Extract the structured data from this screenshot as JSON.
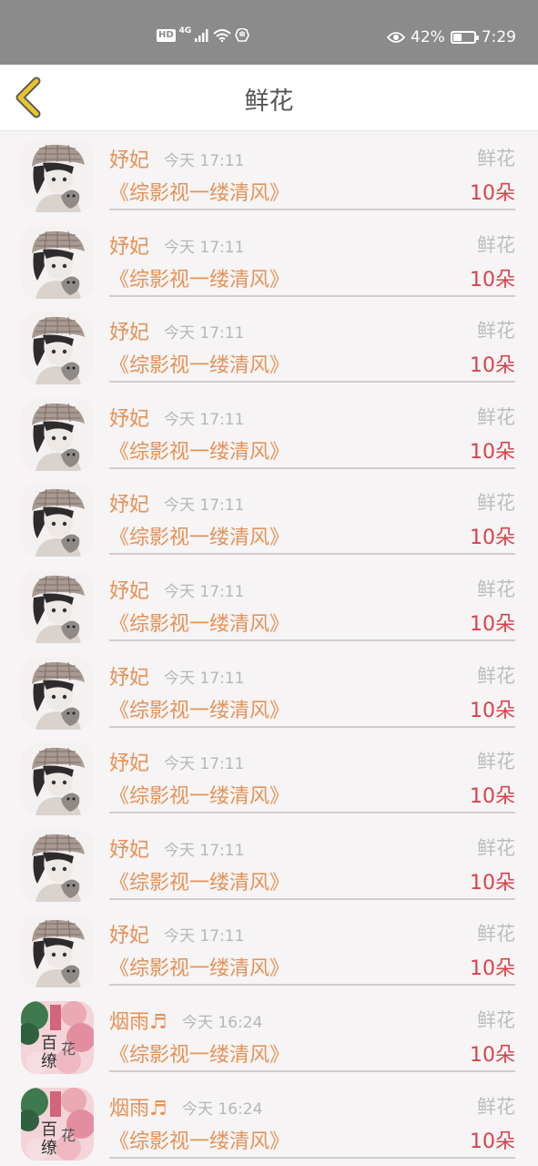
{
  "status_bar": {
    "hd": "HD",
    "network": "4G",
    "battery_percent": "42%",
    "battery_level": 0.42,
    "time": "7:29"
  },
  "nav": {
    "back_icon": "chevron-left-icon",
    "title": "鲜花",
    "accent_color": "#e8c42a"
  },
  "records": [
    {
      "user": "妤妃",
      "time": "今天 17:11",
      "gift": "鲜花",
      "book": "《综影视一缕清风》",
      "count": "10朵",
      "avatar": "cap-girl-avatar"
    },
    {
      "user": "妤妃",
      "time": "今天 17:11",
      "gift": "鲜花",
      "book": "《综影视一缕清风》",
      "count": "10朵",
      "avatar": "cap-girl-avatar"
    },
    {
      "user": "妤妃",
      "time": "今天 17:11",
      "gift": "鲜花",
      "book": "《综影视一缕清风》",
      "count": "10朵",
      "avatar": "cap-girl-avatar"
    },
    {
      "user": "妤妃",
      "time": "今天 17:11",
      "gift": "鲜花",
      "book": "《综影视一缕清风》",
      "count": "10朵",
      "avatar": "cap-girl-avatar"
    },
    {
      "user": "妤妃",
      "time": "今天 17:11",
      "gift": "鲜花",
      "book": "《综影视一缕清风》",
      "count": "10朵",
      "avatar": "cap-girl-avatar"
    },
    {
      "user": "妤妃",
      "time": "今天 17:11",
      "gift": "鲜花",
      "book": "《综影视一缕清风》",
      "count": "10朵",
      "avatar": "cap-girl-avatar"
    },
    {
      "user": "妤妃",
      "time": "今天 17:11",
      "gift": "鲜花",
      "book": "《综影视一缕清风》",
      "count": "10朵",
      "avatar": "cap-girl-avatar"
    },
    {
      "user": "妤妃",
      "time": "今天 17:11",
      "gift": "鲜花",
      "book": "《综影视一缕清风》",
      "count": "10朵",
      "avatar": "cap-girl-avatar"
    },
    {
      "user": "妤妃",
      "time": "今天 17:11",
      "gift": "鲜花",
      "book": "《综影视一缕清风》",
      "count": "10朵",
      "avatar": "cap-girl-avatar"
    },
    {
      "user": "妤妃",
      "time": "今天 17:11",
      "gift": "鲜花",
      "book": "《综影视一缕清风》",
      "count": "10朵",
      "avatar": "cap-girl-avatar"
    },
    {
      "user": "烟雨♬",
      "time": "今天 16:24",
      "gift": "鲜花",
      "book": "《综影视一缕清风》",
      "count": "10朵",
      "avatar": "flower-book-cover-avatar"
    },
    {
      "user": "烟雨♬",
      "time": "今天 16:24",
      "gift": "鲜花",
      "book": "《综影视一缕清风》",
      "count": "10朵",
      "avatar": "flower-book-cover-avatar"
    }
  ]
}
